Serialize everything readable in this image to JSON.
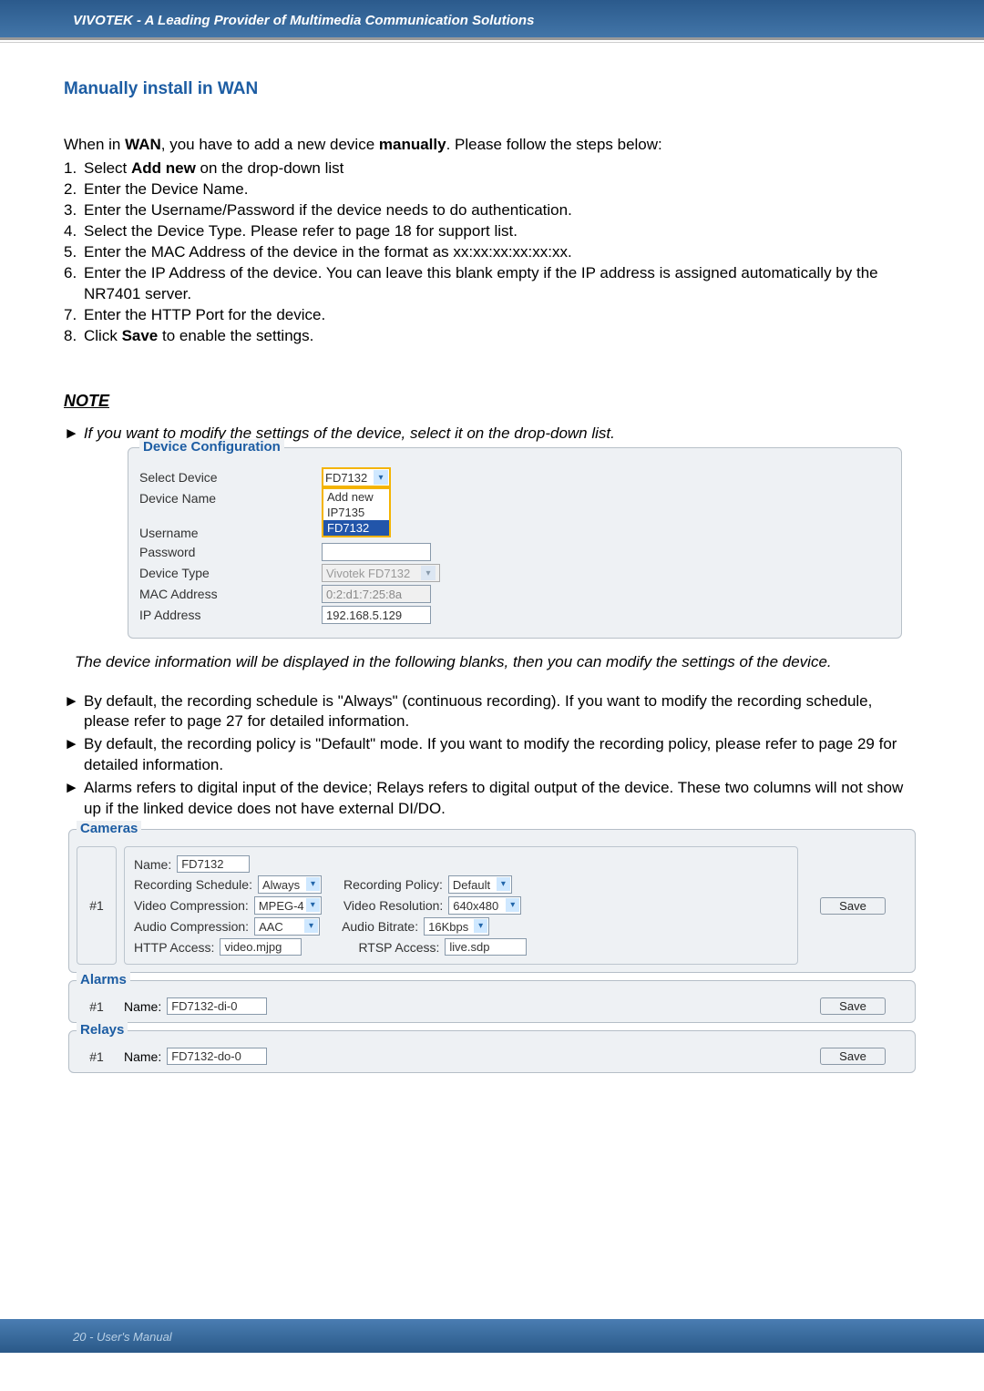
{
  "header": {
    "title": "VIVOTEK - A Leading Provider of Multimedia Communication Solutions"
  },
  "title": "Manually install in WAN",
  "intro": "When in <b>WAN</b>, you have to add a new device <b>manually</b>. Please follow the steps below:",
  "intro_prefix": "When in ",
  "intro_wan": "WAN",
  "intro_mid": ", you have to add a new device ",
  "intro_manually": "manually",
  "intro_suffix": ". Please follow the steps below:",
  "steps": [
    {
      "n": "1.",
      "t": "Select ",
      "b": "Add new",
      "t2": " on the drop-down list"
    },
    {
      "n": "2.",
      "t": "Enter the Device Name."
    },
    {
      "n": "3.",
      "t": "Enter the Username/Password if the device needs to do authentication."
    },
    {
      "n": "4.",
      "t": "Select the Device Type. Please refer to page 18 for support list."
    },
    {
      "n": "5.",
      "t": "Enter the MAC Address of the device in the format as xx:xx:xx:xx:xx:xx."
    },
    {
      "n": "6.",
      "t": "Enter the IP Address of the device. You can leave this blank empty if the IP address is assigned automatically by the NR7401 server."
    },
    {
      "n": "7.",
      "t": "Enter the HTTP Port for the device."
    },
    {
      "n": "8.",
      "t": "Click ",
      "b": "Save",
      "t2": " to enable the settings."
    }
  ],
  "note_head": "NOTE",
  "note1": "If you want to modify the settings of the device, select it on the drop-down list.",
  "device_config": {
    "legend": "Device Configuration",
    "select_device_label": "Select Device",
    "select_device_value": "FD7132",
    "dropdown_options": [
      "Add new",
      "IP7135",
      "FD7132"
    ],
    "device_name_label": "Device Name",
    "username_label": "Username",
    "password_label": "Password",
    "device_type_label": "Device Type",
    "device_type_value": "Vivotek FD7132",
    "mac_label": "MAC Address",
    "mac_value": "0:2:d1:7:25:8a",
    "ip_label": "IP Address",
    "ip_value": "192.168.5.129"
  },
  "note_after": "The device information will be displayed in the following blanks, then you can modify the settings of the device.",
  "bullets": [
    "By default, the recording schedule is \"Always\" (continuous recording). If you want to modify the recording schedule, please refer to page 27 for detailed information.",
    "By default, the recording policy is \"Default\" mode. If you want to modify the recording policy, please refer to page 29 for detailed information.",
    "Alarms refers to digital input of the device; Relays refers to digital output of the device. These two columns will not show up if the linked device does not have external DI/DO."
  ],
  "cameras": {
    "legend": "Cameras",
    "idx": "#1",
    "name_label": "Name:",
    "name_value": "FD7132",
    "rec_sched_label": "Recording Schedule:",
    "rec_sched_value": "Always",
    "rec_policy_label": "Recording Policy:",
    "rec_policy_value": "Default",
    "vid_comp_label": "Video Compression:",
    "vid_comp_value": "MPEG-4",
    "vid_res_label": "Video Resolution:",
    "vid_res_value": "640x480",
    "aud_comp_label": "Audio Compression:",
    "aud_comp_value": "AAC",
    "aud_bitrate_label": "Audio Bitrate:",
    "aud_bitrate_value": "16Kbps",
    "http_label": "HTTP Access:",
    "http_value": "video.mjpg",
    "rtsp_label": "RTSP Access:",
    "rtsp_value": "live.sdp",
    "save": "Save"
  },
  "alarms": {
    "legend": "Alarms",
    "idx": "#1",
    "name_label": "Name:",
    "name_value": "FD7132-di-0",
    "save": "Save"
  },
  "relays": {
    "legend": "Relays",
    "idx": "#1",
    "name_label": "Name:",
    "name_value": "FD7132-do-0",
    "save": "Save"
  },
  "footer": "20 - User's Manual"
}
